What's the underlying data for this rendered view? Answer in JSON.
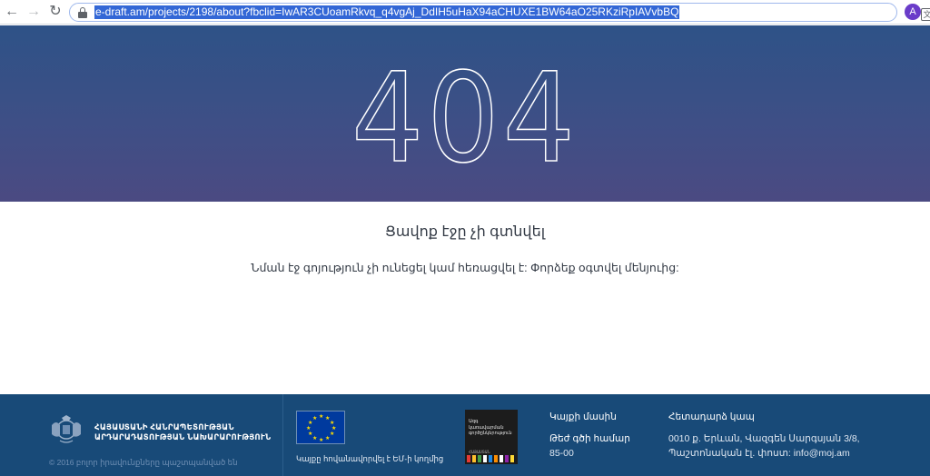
{
  "browser": {
    "url": "e-draft.am/projects/2198/about?fbclid=IwAR3CUoamRkvq_q4vgAj_DdIH5uHaX94aCHUXE1BW64aO25RKziRpIAVvbBQ",
    "back_icon": "arrow-left-icon",
    "forward_icon": "arrow-right-icon",
    "reload_icon": "reload-icon",
    "translate_icon": "translate-icon",
    "bookmark_icon": "star-icon",
    "profile_initial": "A",
    "profile_color": "#6a3cc9"
  },
  "hero": {
    "code": "404",
    "gradient_top": "#2e5287",
    "gradient_bottom": "#4b4a82"
  },
  "content": {
    "title": "Ցավոք էջը չի գտնվել",
    "message": "Նման էջ գոյություն չի ունեցել կամ հեռացվել է: Փորձեք օգտվել մենյուից:"
  },
  "footer": {
    "background": "#184a78",
    "ministry_line1": "ՀԱՅԱՍՏԱՆԻ ՀԱՆՐԱՊԵՏՈՒԹՅԱՆ",
    "ministry_line2": "ԱՐԴԱՐԱԴԱՏՈՒԹՅԱՆ ՆԱԽԱՐԱՐՈՒԹՅՈՒՆ",
    "copyright": "© 2016 բոլոր իրավունքները պաշտպանված են",
    "eu_caption": "Կայքը հովանավորվել է ԵՄ-ի կողմից",
    "reforms_logo_text": [
      "Ազգ",
      "կառավարման",
      "գործընկերություն"
    ],
    "reforms_logo_sub": "ՀԱՅԱՍՏԱՆ",
    "about_link": "Կայքի մասին",
    "hotline_label": "Թեժ գծի համար",
    "hotline_number": "85-00",
    "contact_head": "Հետադարձ կապ",
    "address_line1": "0010 ք. Երևան, Վազգեն Սարգսյան 3/8,",
    "address_line2": "Պաշտոնական էլ. փոստ: info@moj.am"
  }
}
